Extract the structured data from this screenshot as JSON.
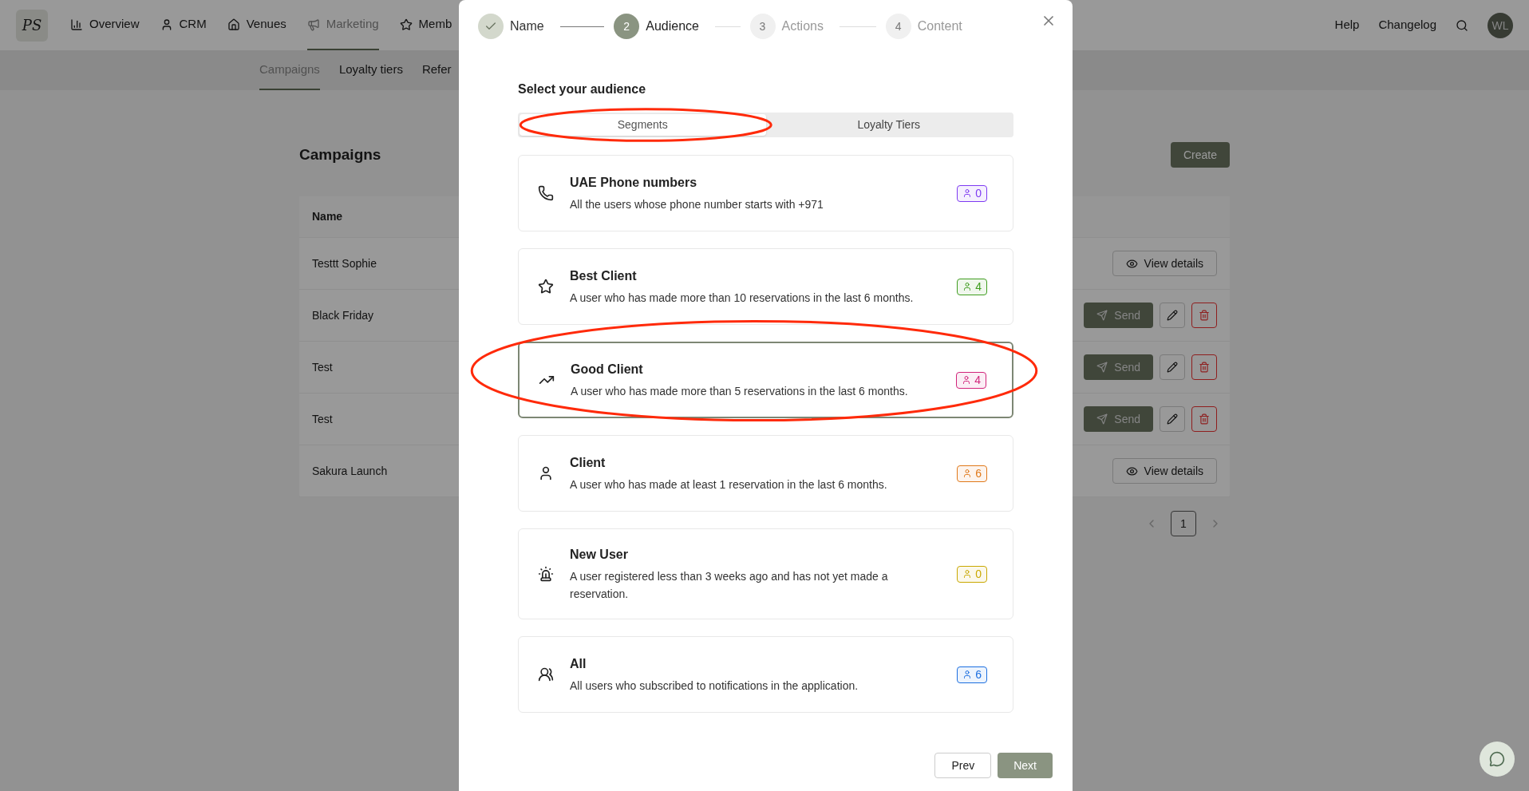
{
  "nav": {
    "logo": "PS",
    "items": [
      {
        "label": "Overview",
        "selected": false
      },
      {
        "label": "CRM",
        "selected": false
      },
      {
        "label": "Venues",
        "selected": false
      },
      {
        "label": "Marketing",
        "selected": true
      },
      {
        "label": "Memb",
        "selected": false
      }
    ],
    "right_links": [
      "Help",
      "Changelog"
    ],
    "avatar": "WL"
  },
  "subnav": [
    {
      "label": "Campaigns",
      "selected": true
    },
    {
      "label": "Loyalty tiers",
      "selected": false
    },
    {
      "label": "Refer",
      "selected": false
    }
  ],
  "page": {
    "title": "Campaigns",
    "create_button": "Create",
    "table": {
      "columns": [
        "Name"
      ],
      "rows": [
        {
          "name": "Testtt Sophie",
          "kind": "sent",
          "actions": [
            "View details"
          ]
        },
        {
          "name": "Black Friday",
          "kind": "draft",
          "actions": [
            "Send"
          ]
        },
        {
          "name": "Test",
          "kind": "draft",
          "actions": [
            "Send"
          ]
        },
        {
          "name": "Test",
          "kind": "draft",
          "actions": [
            "Send"
          ]
        },
        {
          "name": "Sakura Launch",
          "kind": "sent",
          "actions": [
            "View details"
          ]
        }
      ]
    },
    "pagination": {
      "pages": [
        {
          "label": "1",
          "selected": true
        }
      ]
    }
  },
  "modal": {
    "steps": [
      {
        "label": "Name",
        "completed": true,
        "active": false
      },
      {
        "label": "Audience",
        "number": "2",
        "completed": false,
        "active": true
      },
      {
        "label": "Actions",
        "number": "3",
        "completed": false,
        "active": false
      },
      {
        "label": "Content",
        "number": "4",
        "completed": false,
        "active": false
      }
    ],
    "heading": "Select your audience",
    "tabs": [
      {
        "label": "Segments",
        "selected": true,
        "circled": true
      },
      {
        "label": "Loyalty Tiers",
        "selected": false,
        "circled": false
      }
    ],
    "segments": [
      {
        "title": "UAE Phone numbers",
        "description": "All the users whose phone number starts with +971",
        "count": "0",
        "color": "#7e3af2",
        "selected": false,
        "circled": false
      },
      {
        "title": "Best Client",
        "description": "A user who has made more than 10 reservations in the last 6 months.",
        "count": "4",
        "color": "#3f9d1f",
        "selected": false,
        "circled": false
      },
      {
        "title": "Good Client",
        "description": "A user who has made more than 5 reservations in the last 6 months.",
        "count": "4",
        "color": "#d1237a",
        "selected": true,
        "circled": true
      },
      {
        "title": "Client",
        "description": "A user who has made at least 1 reservation in the last 6 months.",
        "count": "6",
        "color": "#e0791a",
        "selected": false,
        "circled": false
      },
      {
        "title": "New User",
        "description": "A user registered less than 3 weeks ago and has not yet made a reservation.",
        "count": "0",
        "color": "#c9a800",
        "selected": false,
        "circled": false
      },
      {
        "title": "All",
        "description": "All users who subscribed to notifications in the application.",
        "count": "6",
        "color": "#1c6fe0",
        "selected": false,
        "circled": false
      }
    ],
    "buttons": {
      "prev": "Prev",
      "next": "Next"
    }
  }
}
